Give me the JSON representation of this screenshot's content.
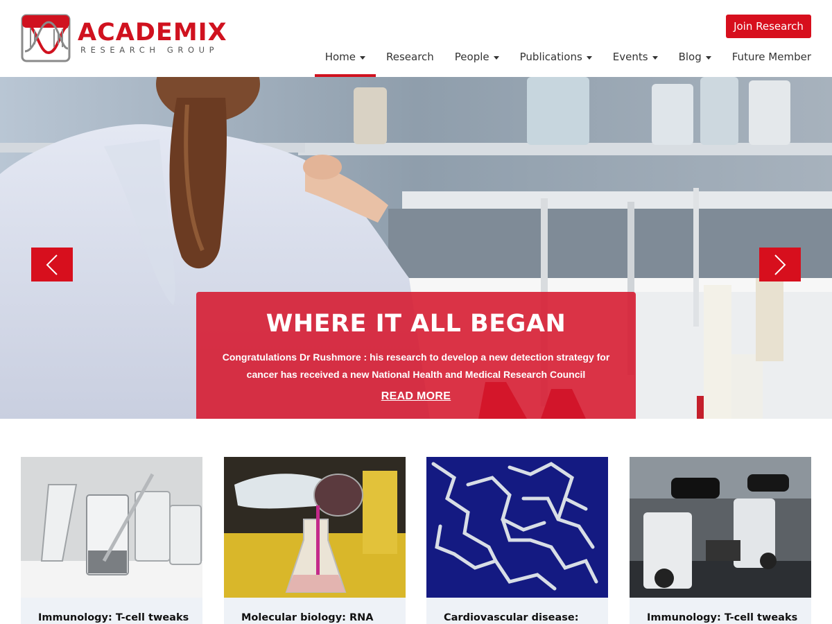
{
  "brand": {
    "name": "ACADEMIX",
    "tagline": "RESEARCH GROUP",
    "accent": "#d0121f"
  },
  "header": {
    "join_label": "Join Research"
  },
  "nav": {
    "items": [
      {
        "label": "Home",
        "dropdown": true,
        "active": true
      },
      {
        "label": "Research",
        "dropdown": false,
        "active": false
      },
      {
        "label": "People",
        "dropdown": true,
        "active": false
      },
      {
        "label": "Publications",
        "dropdown": true,
        "active": false
      },
      {
        "label": "Events",
        "dropdown": true,
        "active": false
      },
      {
        "label": "Blog",
        "dropdown": true,
        "active": false
      },
      {
        "label": "Future Member",
        "dropdown": false,
        "active": false
      }
    ]
  },
  "hero": {
    "title": "WHERE IT ALL BEGAN",
    "text": "Congratulations Dr Rushmore : his research to develop a new detection strategy for cancer has received a new National Health and Medical Research Council",
    "link_label": "READ MORE",
    "prev_icon": "chevron-left-icon",
    "next_icon": "chevron-right-icon"
  },
  "cards": [
    {
      "title": "Immunology: T-cell tweaks",
      "image": "glass-beakers-image"
    },
    {
      "title": "Molecular biology: RNA",
      "image": "pouring-flask-image"
    },
    {
      "title": "Cardiovascular disease:",
      "image": "molecule-model-image"
    },
    {
      "title": "Immunology: T-cell tweaks",
      "image": "microscopes-image"
    }
  ]
}
